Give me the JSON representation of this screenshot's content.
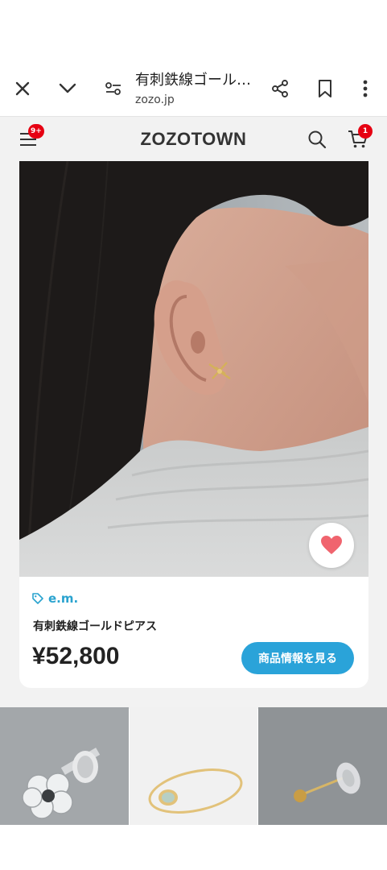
{
  "browser": {
    "title": "有刺鉄線ゴール…",
    "url": "zozo.jp"
  },
  "header": {
    "logo": "ZOZOTOWN",
    "menu_badge": "9+",
    "cart_badge": "1"
  },
  "product": {
    "brand": "e.m.",
    "name": "有刺鉄線ゴールドピアス",
    "price": "¥52,800",
    "cta_label": "商品情報を見る"
  },
  "colors": {
    "accent": "#2aa3d9",
    "badge": "#e60012",
    "favorite": "#f0646e"
  }
}
